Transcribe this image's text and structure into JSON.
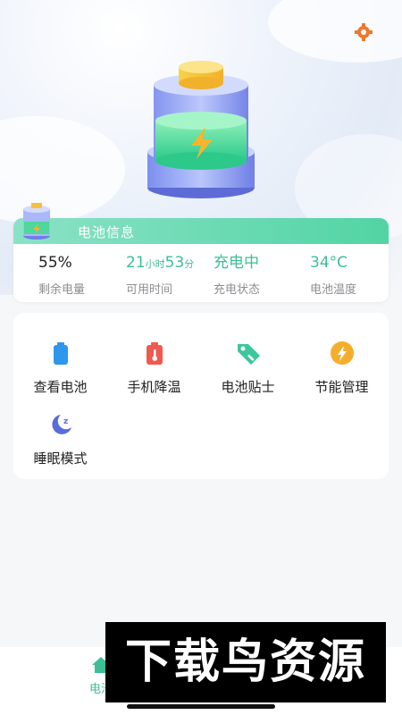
{
  "battery_info": {
    "title": "电池信息",
    "stats": [
      {
        "value": "55%",
        "label": "剩余电量"
      },
      {
        "value_hours": "21",
        "hours_unit": "小时",
        "value_minutes": "53",
        "minutes_unit": "分",
        "label": "可用时间"
      },
      {
        "value": "充电中",
        "label": "充电状态"
      },
      {
        "value": "34°C",
        "label": "电池温度"
      }
    ]
  },
  "functions": [
    {
      "label": "查看电池",
      "icon": "battery-icon"
    },
    {
      "label": "手机降温",
      "icon": "thermometer-icon"
    },
    {
      "label": "电池贴士",
      "icon": "tag-icon"
    },
    {
      "label": "节能管理",
      "icon": "lightning-icon"
    },
    {
      "label": "睡眠模式",
      "icon": "moon-sleep-icon"
    }
  ],
  "tabbar": {
    "home_label": "电池"
  },
  "watermark": "下载鸟资源",
  "colors": {
    "accent": "#3dbf95",
    "header_gradient_start": "#8be2c6",
    "header_gradient_end": "#52d4a4"
  }
}
